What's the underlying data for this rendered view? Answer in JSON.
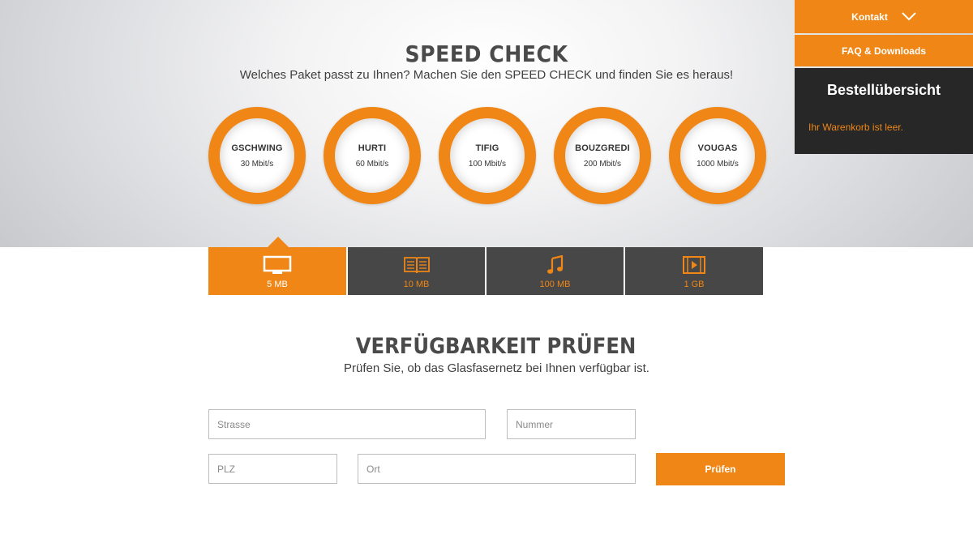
{
  "hero": {
    "title": "SPEED CHECK",
    "subtitle": "Welches Paket passt zu Ihnen? Machen Sie den SPEED CHECK und finden Sie es heraus!"
  },
  "plans": [
    {
      "name": "GSCHWING",
      "speed": "30 Mbit/s"
    },
    {
      "name": "HURTI",
      "speed": "60 Mbit/s"
    },
    {
      "name": "TIFIG",
      "speed": "100 Mbit/s"
    },
    {
      "name": "BOUZGREDI",
      "speed": "200 Mbit/s"
    },
    {
      "name": "VOUGAS",
      "speed": "1000 Mbit/s"
    }
  ],
  "usage_tabs": [
    {
      "label": "5 MB",
      "icon": "tv-icon",
      "active": true
    },
    {
      "label": "10 MB",
      "icon": "newspaper-icon",
      "active": false
    },
    {
      "label": "100 MB",
      "icon": "music-note-icon",
      "active": false
    },
    {
      "label": "1 GB",
      "icon": "video-icon",
      "active": false
    }
  ],
  "availability": {
    "title": "VERFÜGBARKEIT PRÜFEN",
    "subtitle": "Prüfen Sie, ob das Glasfasernetz bei Ihnen verfügbar ist.",
    "street_placeholder": "Strasse",
    "number_placeholder": "Nummer",
    "zip_placeholder": "PLZ",
    "city_placeholder": "Ort",
    "submit_label": "Prüfen"
  },
  "sidebar": {
    "contact_label": "Kontakt",
    "faq_label": "FAQ & Downloads",
    "order_title": "Bestellübersicht",
    "cart_empty": "Ihr Warenkorb ist leer."
  },
  "colors": {
    "accent": "#ef8615",
    "dark": "#474747",
    "panel": "#272727"
  }
}
